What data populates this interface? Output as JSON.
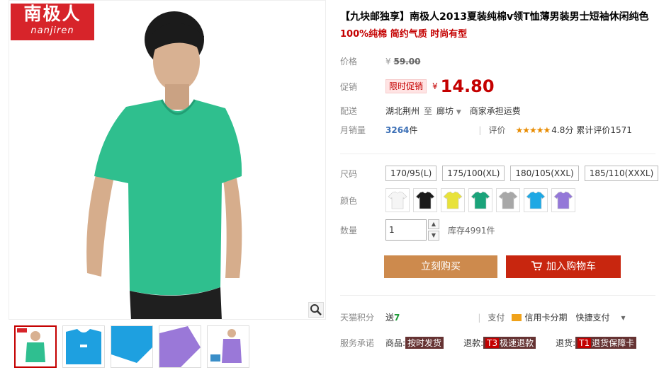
{
  "brand": {
    "logo_cn": "南极人",
    "logo_en": "nanjiren"
  },
  "product": {
    "title": "【九块邮独享】南极人2013夏装纯棉v领T恤薄男装男士短袖休闲纯色",
    "subtitle": "100%纯棉 简约气质 时尚有型"
  },
  "price": {
    "label": "价格",
    "currency": "¥",
    "original": "59.00"
  },
  "promo": {
    "label": "促销",
    "tag": "限时促销",
    "currency": "¥",
    "price": "14.80"
  },
  "shipping": {
    "label": "配送",
    "from": "湖北荆州",
    "to_word": "至",
    "to": "廊坊",
    "note": "商家承担运费"
  },
  "sales": {
    "label": "月销量",
    "count": "3264",
    "unit": "件",
    "rating_label": "评价",
    "stars": "★★★★★",
    "score": "4.8分",
    "reviews": "累计评价1571"
  },
  "size": {
    "label": "尺码",
    "options": [
      "170/95(L)",
      "175/100(XL)",
      "180/105(XXL)",
      "185/110(XXXL)"
    ]
  },
  "color": {
    "label": "颜色",
    "swatches": [
      "#f5f5f5",
      "#1a1a1a",
      "#e8e23a",
      "#1aa37a",
      "#a7a7a7",
      "#1ea8e4",
      "#9478d8"
    ]
  },
  "quantity": {
    "label": "数量",
    "value": "1",
    "up": "▲",
    "down": "▼",
    "stock": "库存4991件"
  },
  "buttons": {
    "buy": "立刻购买",
    "cart": "加入购物车"
  },
  "points": {
    "label": "天猫积分",
    "send": "送",
    "value": "7",
    "pay_label": "支付",
    "credit": "信用卡分期",
    "quick": "快捷支付",
    "chev": "▾"
  },
  "service": {
    "label": "服务承诺",
    "items": [
      {
        "key": "商品:",
        "tag": "按时发货",
        "t": ""
      },
      {
        "key": "退款:",
        "tag": "极速退款",
        "t": "T3"
      },
      {
        "key": "退货:",
        "tag": "退货保障卡",
        "t": "T1"
      }
    ]
  },
  "thumbs": {
    "colors": [
      "#2fbf90",
      "#1ea0e0",
      "#1ea0e0",
      "#9a78d8",
      "#9a78d8"
    ]
  }
}
